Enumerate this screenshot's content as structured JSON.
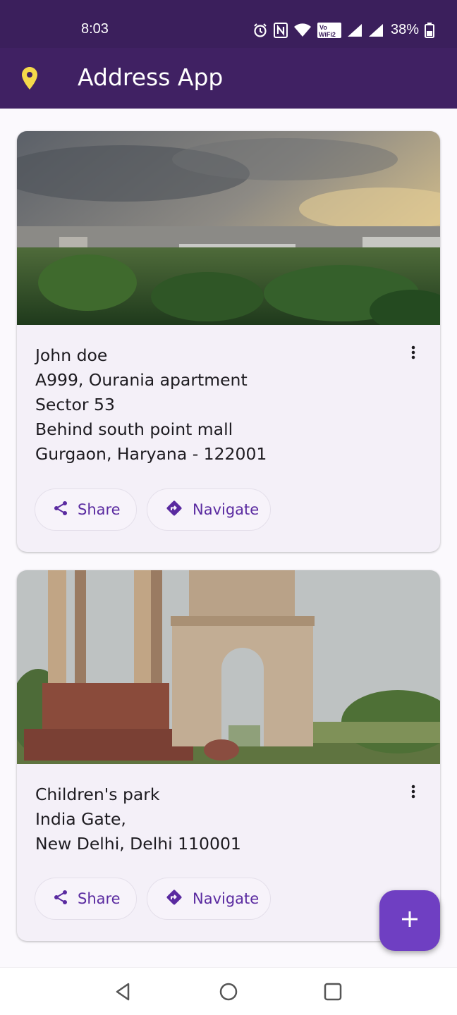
{
  "status_bar": {
    "time": "8:03",
    "battery": "38%",
    "icons": [
      "alarm-icon",
      "nfc-icon",
      "wifi-icon",
      "vowifi-icon",
      "signal-icon",
      "signal-icon",
      "battery-icon"
    ]
  },
  "app_bar": {
    "icon": "location-pin-icon",
    "title": "Address App",
    "background": "#402163",
    "pin_color": "#f5d94a"
  },
  "addresses": [
    {
      "image": "city-skyline-photo",
      "lines": [
        "John doe",
        "A999, Ourania apartment",
        "Sector 53",
        "Behind south point mall",
        "Gurgaon, Haryana - 122001"
      ],
      "share_label": "Share",
      "navigate_label": "Navigate"
    },
    {
      "image": "india-gate-photo",
      "lines": [
        "Children's park",
        "India Gate,",
        "New Delhi, Delhi 110001"
      ],
      "share_label": "Share",
      "navigate_label": "Navigate"
    }
  ],
  "fab": {
    "icon": "plus-icon",
    "color": "#6f3fc2"
  },
  "nav_bar": {
    "buttons": [
      "back-icon",
      "home-icon",
      "recents-icon"
    ]
  },
  "colors": {
    "accent": "#5a2aa0",
    "card_background": "#f4f0f8"
  }
}
